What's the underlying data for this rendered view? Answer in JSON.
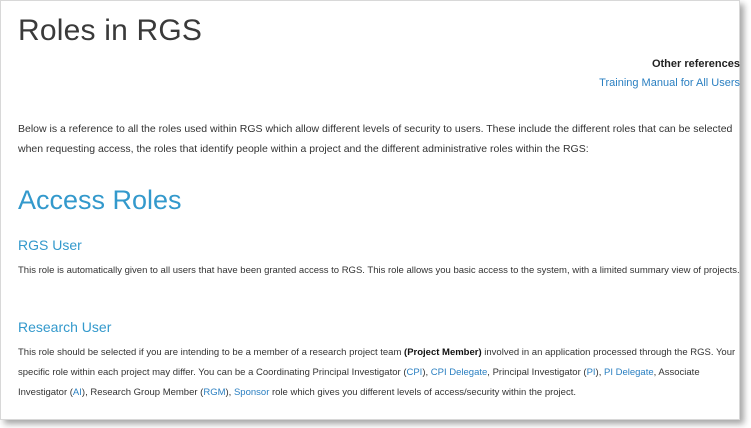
{
  "page": {
    "title": "Roles in RGS",
    "other_references_heading": "Other references",
    "other_references_link": "Training Manual for All Users",
    "intro": "Below is a reference to all the roles used within RGS which allow different levels of security to users.  These include the different roles that can be selected when requesting access, the roles that identify people within a project and the different administrative roles within the RGS:"
  },
  "access_roles": {
    "heading": "Access Roles",
    "rgs_user": {
      "heading": "RGS User",
      "text": "This role is automatically given to all users that have been granted access to RGS. This role allows you basic access to the system, with a limited summary view of projects."
    },
    "research_user": {
      "heading": "Research User",
      "t1": "This role should be selected if you are intending to be a member of a research project team ",
      "bold": "(Project Member)",
      "t2": " involved in an application processed through the RGS.  Your specific role within each project may differ.   You can be a Coordinating Principal Investigator (",
      "cpi": "CPI",
      "t3": "), ",
      "cpi_delegate": "CPI Delegate",
      "t4": ", Principal Investigator (",
      "pi": "PI",
      "t5": "), ",
      "pi_delegate": "PI Delegate",
      "t6": ", Associate Investigator (",
      "ai": "AI",
      "t7": "), Research Group Member (",
      "rgm": "RGM",
      "t8": "), ",
      "sponsor": "Sponsor",
      "t9": " role which gives you different levels of access/security within the project."
    }
  },
  "colors": {
    "accent": "#3399cc",
    "link": "#2a7fc1"
  }
}
